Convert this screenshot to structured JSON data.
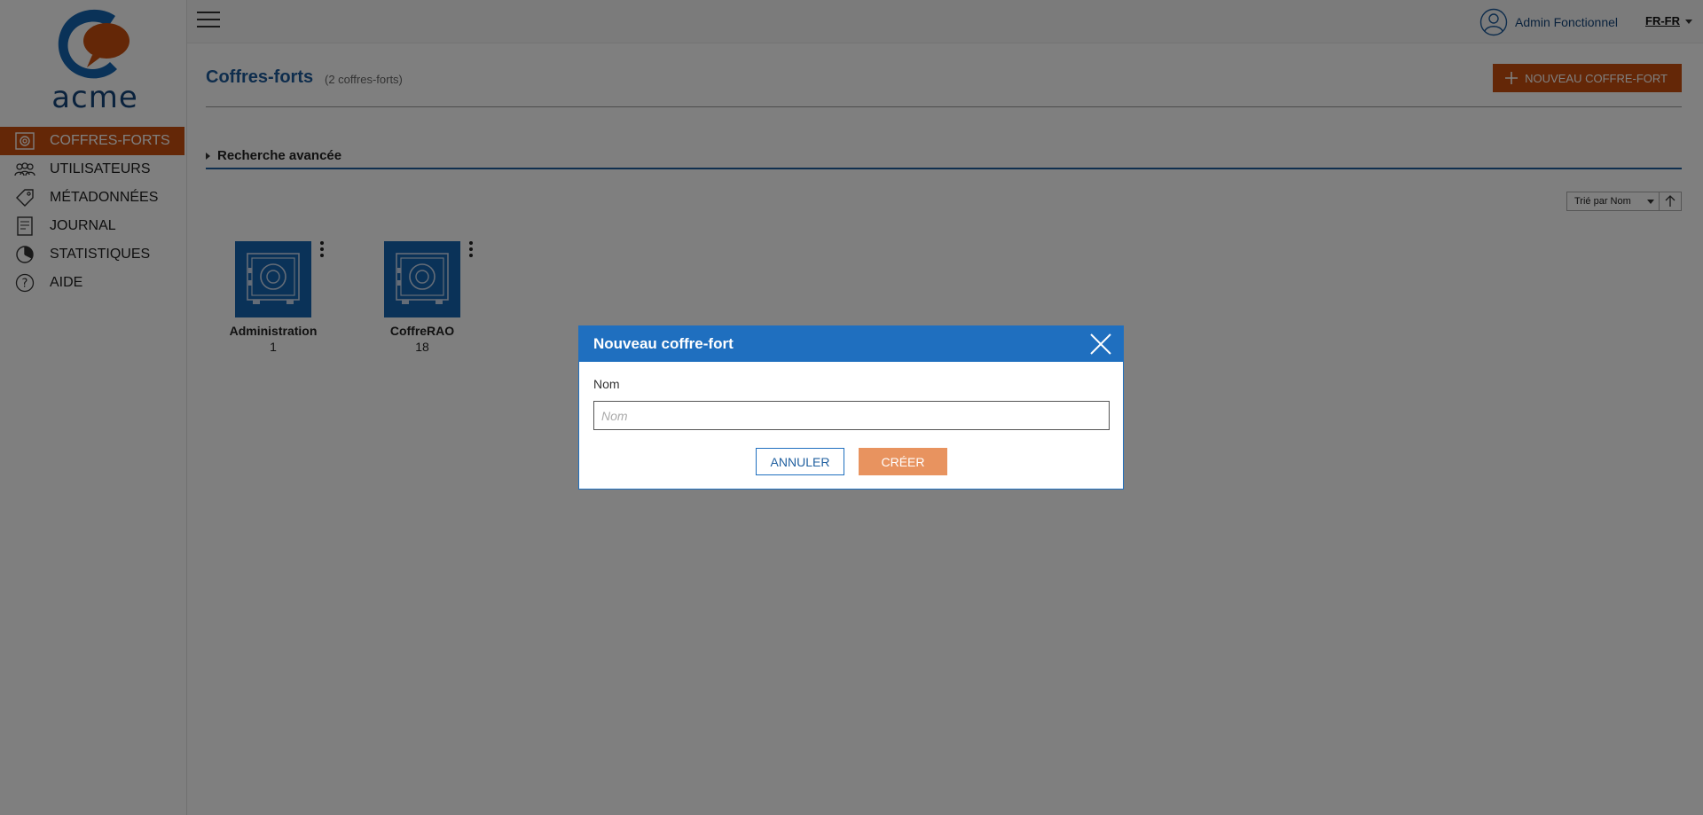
{
  "brand": {
    "logo_text": "acme"
  },
  "sidebar": {
    "items": [
      {
        "label": "COFFRES-FORTS",
        "icon": "vault-icon",
        "active": true
      },
      {
        "label": "UTILISATEURS",
        "icon": "users-icon"
      },
      {
        "label": "MÉTADONNÉES",
        "icon": "tag-icon"
      },
      {
        "label": "JOURNAL",
        "icon": "journal-icon"
      },
      {
        "label": "STATISTIQUES",
        "icon": "pie-chart-icon"
      },
      {
        "label": "AIDE",
        "icon": "help-icon"
      }
    ]
  },
  "topbar": {
    "user_name": "Admin Fonctionnel",
    "language": "FR-FR"
  },
  "main": {
    "title": "Coffres-forts",
    "count_label": "(2 coffres-forts)",
    "new_button_label": "NOUVEAU COFFRE-FORT",
    "advanced_search_label": "Recherche avancée",
    "sort_label": "Trié par Nom",
    "vaults": [
      {
        "name": "Administration",
        "count": "1"
      },
      {
        "name": "CoffreRAO",
        "count": "18"
      }
    ]
  },
  "dialog": {
    "title": "Nouveau coffre-fort",
    "field_label": "Nom",
    "field_placeholder": "Nom",
    "field_value": "",
    "cancel_label": "ANNULER",
    "create_label": "CRÉER"
  },
  "colors": {
    "brand_orange": "#c94f0f",
    "brand_blue": "#1f6fbf",
    "title_blue": "#1d5a9a",
    "create_button": "#e8935f"
  }
}
